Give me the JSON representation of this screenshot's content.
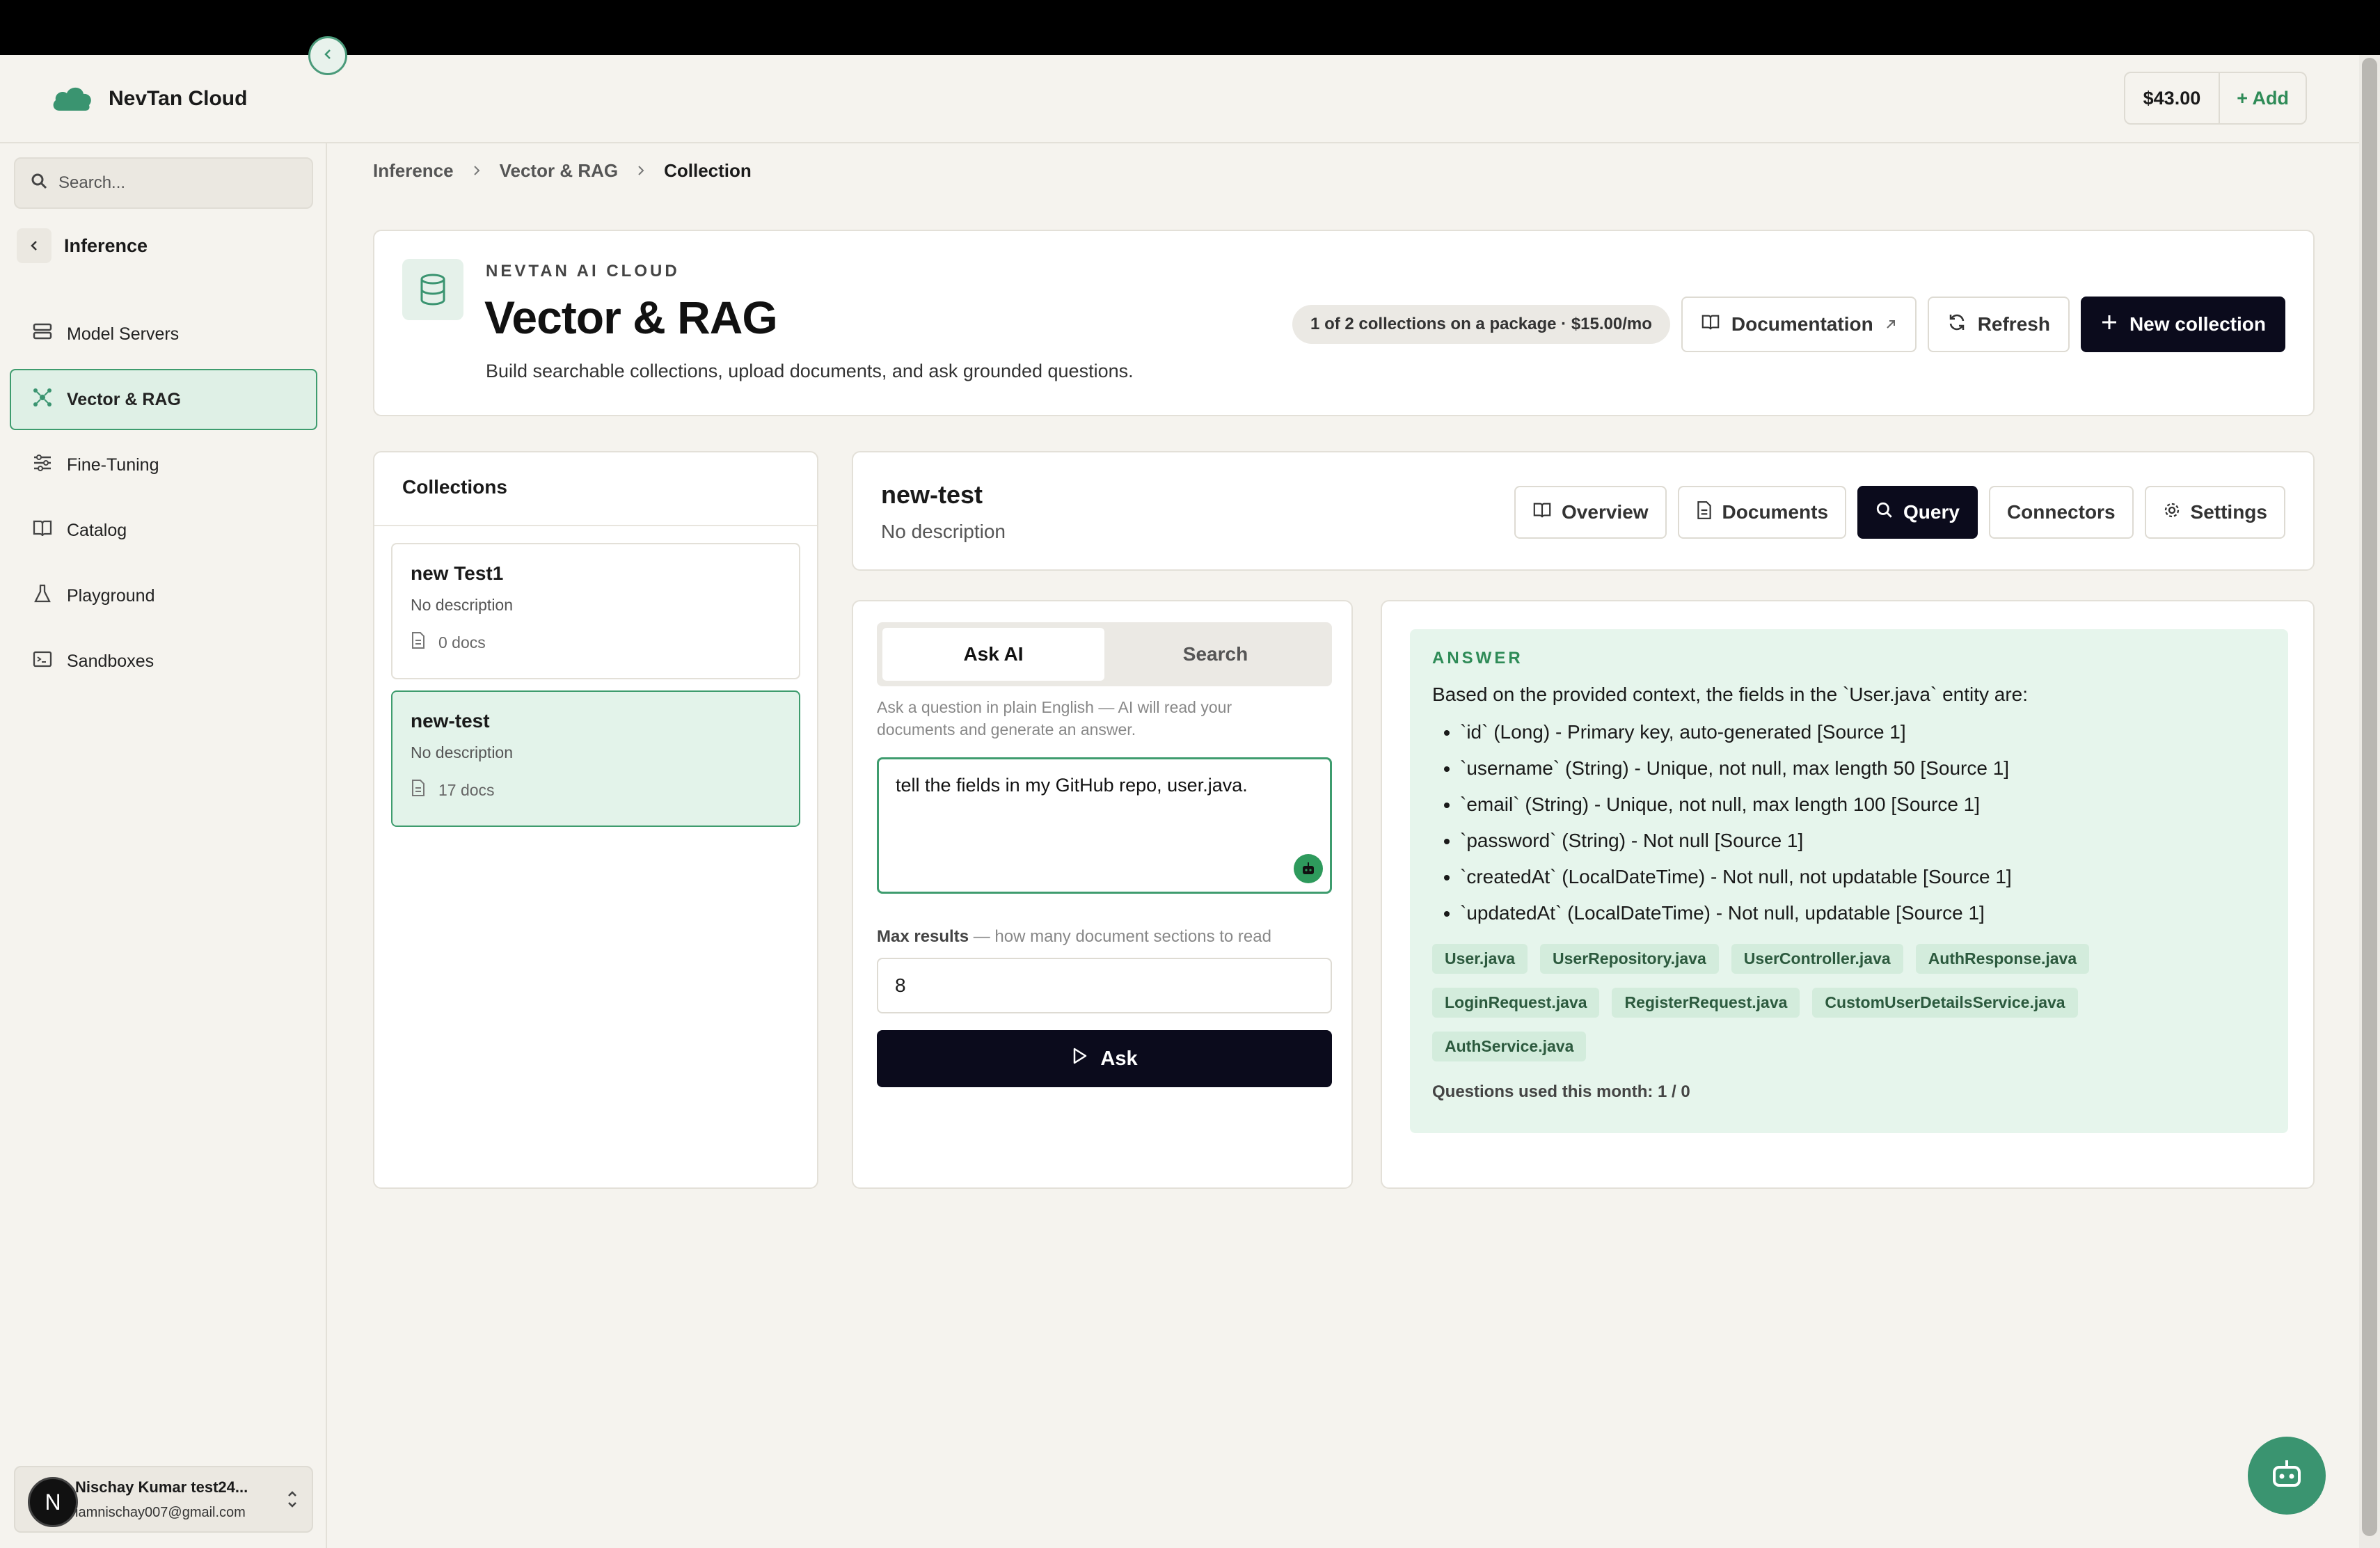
{
  "app": {
    "name": "NevTan Cloud",
    "balance": "$43.00",
    "add_label": "+ Add"
  },
  "sidebar": {
    "search_placeholder": "Search...",
    "back_label": "Inference",
    "items": [
      {
        "label": "Model Servers",
        "icon": "server-icon"
      },
      {
        "label": "Vector & RAG",
        "icon": "network-icon",
        "active": true
      },
      {
        "label": "Fine-Tuning",
        "icon": "sliders-icon"
      },
      {
        "label": "Catalog",
        "icon": "book-icon"
      },
      {
        "label": "Playground",
        "icon": "flask-icon"
      },
      {
        "label": "Sandboxes",
        "icon": "terminal-icon"
      }
    ],
    "user": {
      "initial": "N",
      "name": "Nischay Kumar test24...",
      "email": "iamnischay007@gmail.com"
    }
  },
  "breadcrumb": [
    "Inference",
    "Vector & RAG",
    "Collection"
  ],
  "hero": {
    "kicker": "NEVTAN AI CLOUD",
    "title": "Vector & RAG",
    "description": "Build searchable collections, upload documents, and ask grounded questions.",
    "package_pill": "1 of 2 collections on a package · $15.00/mo",
    "documentation_label": "Documentation",
    "refresh_label": "Refresh",
    "new_collection_label": "New collection"
  },
  "collections": {
    "title": "Collections",
    "items": [
      {
        "name": "new Test1",
        "description": "No description",
        "docs": "0 docs"
      },
      {
        "name": "new-test",
        "description": "No description",
        "docs": "17 docs",
        "active": true
      }
    ]
  },
  "collection": {
    "name": "new-test",
    "description": "No description",
    "tabs": [
      "Overview",
      "Documents",
      "Query",
      "Connectors",
      "Settings"
    ],
    "active_tab": "Query"
  },
  "query": {
    "modes": [
      "Ask AI",
      "Search"
    ],
    "active_mode": "Ask AI",
    "help": "Ask a question in plain English — AI will read your documents and generate an answer.",
    "question": "tell the fields in my GitHub repo, user.java.",
    "max_results_label": "Max results",
    "max_results_hint": "— how many document sections to read",
    "max_results_value": "8",
    "ask_label": "Ask"
  },
  "answer": {
    "kicker": "ANSWER",
    "intro": "Based on the provided context, the fields in the `User.java` entity are:",
    "fields": [
      "`id` (Long) - Primary key, auto-generated [Source 1]",
      "`username` (String) - Unique, not null, max length 50 [Source 1]",
      "`email` (String) - Unique, not null, max length 100 [Source 1]",
      "`password` (String) - Not null [Source 1]",
      "`createdAt` (LocalDateTime) - Not null, not updatable [Source 1]",
      "`updatedAt` (LocalDateTime) - Not null, updatable [Source 1]"
    ],
    "sources": [
      "User.java",
      "UserRepository.java",
      "UserController.java",
      "AuthResponse.java",
      "LoginRequest.java",
      "RegisterRequest.java",
      "CustomUserDetailsService.java",
      "AuthService.java"
    ],
    "usage": "Questions used this month: 1 / 0"
  },
  "colors": {
    "accent": "#3e9c6e",
    "dark_button": "#0b0b1c",
    "answer_bg": "#e6f5ec"
  }
}
